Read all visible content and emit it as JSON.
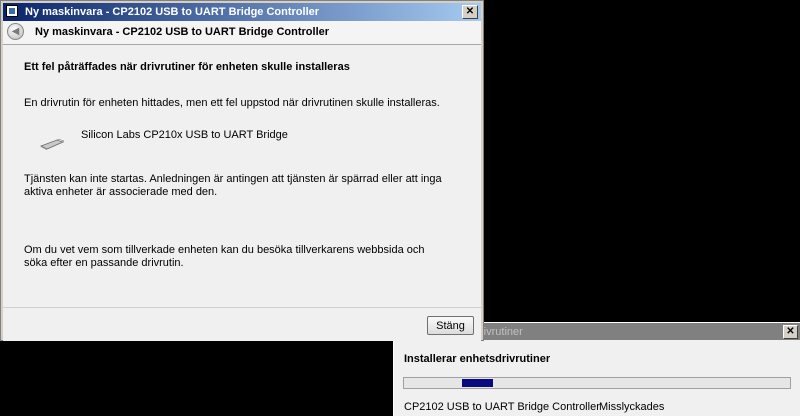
{
  "wizard": {
    "window_title": "Ny maskinvara - CP2102 USB to UART Bridge Controller",
    "header_title": "Ny maskinvara - CP2102 USB to UART Bridge Controller",
    "close_glyph": "✕",
    "back_glyph": "◀",
    "heading": "Ett fel påträffades när drivrutiner för enheten skulle installeras",
    "intro": "En drivrutin för enheten hittades, men ett fel uppstod när drivrutinen skulle installeras.",
    "device_icon": "usb-device-icon",
    "device_label": "Silicon Labs CP210x USB to UART Bridge",
    "reason": "Tjänsten kan inte startas. Anledningen är antingen att tjänsten är spärrad eller att inga aktiva enheter är associerade med den.",
    "advice": "Om du vet vem som tillverkade enheten kan du besöka tillverkarens webbsida och söka efter en passande drivrutin.",
    "close_button": "Stäng"
  },
  "installer": {
    "title_partial": "rivrutiner",
    "close_glyph": "✕",
    "heading": "Installerar enhetsdrivrutiner",
    "device_name": "CP2102 USB to UART Bridge Controller",
    "status": "Misslyckades",
    "progress_start": 0.15,
    "progress_width": 0.08
  },
  "colors": {
    "desktop": "#000000",
    "titlebar_active": "#0a246a",
    "progress_fill": "#0a0a80"
  }
}
